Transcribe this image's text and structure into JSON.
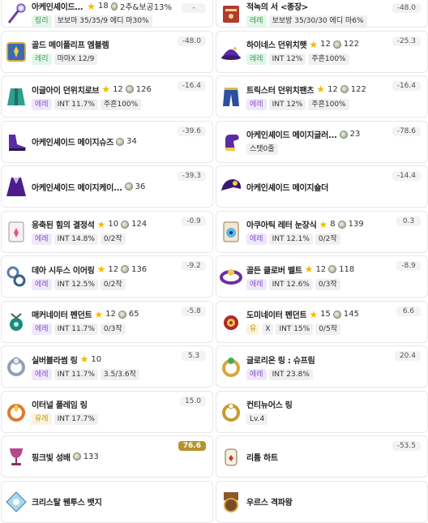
{
  "items": [
    {
      "name": "아케인셰이드 스태프",
      "star": "18",
      "scroll_text": "2추&보공13%",
      "tags": [
        {
          "text": "링리",
          "grade": "legend"
        },
        {
          "text": "보보마 35/35/9 에디 마30%",
          "grade": ""
        }
      ],
      "diff": "-",
      "icon": "staff-icon"
    },
    {
      "name": "적녹의 서 <종장>",
      "star": "",
      "scroll_text": "",
      "tags": [
        {
          "text": "레레",
          "grade": "legend"
        },
        {
          "text": "보보방 35/30/30 에디 마6%",
          "grade": ""
        }
      ],
      "diff": "-48.0",
      "icon": "book-icon"
    },
    {
      "name": "골드 메이플리프 엠블렘",
      "star": "",
      "scroll_text": "",
      "tags": [
        {
          "text": "레리",
          "grade": "legend"
        },
        {
          "text": "마마X 12/9",
          "grade": ""
        }
      ],
      "diff": "-48.0",
      "icon": "emblem-icon"
    },
    {
      "name": "하이네스 던위치햇",
      "star": "12",
      "scroll_text": "122",
      "tags": [
        {
          "text": "레레",
          "grade": "legend"
        },
        {
          "text": "INT 12%",
          "grade": ""
        },
        {
          "text": "주흔100%",
          "grade": ""
        }
      ],
      "diff": "-25.3",
      "icon": "hat-icon"
    },
    {
      "name": "이글아이 던위치로브",
      "star": "12",
      "scroll_text": "126",
      "tags": [
        {
          "text": "에레",
          "grade": "epic"
        },
        {
          "text": "INT 11.7%",
          "grade": ""
        },
        {
          "text": "주흔100%",
          "grade": ""
        }
      ],
      "diff": "-16.4",
      "icon": "robe-icon"
    },
    {
      "name": "트릭스터 던위치팬츠",
      "star": "12",
      "scroll_text": "122",
      "tags": [
        {
          "text": "에레",
          "grade": "epic"
        },
        {
          "text": "INT 12%",
          "grade": ""
        },
        {
          "text": "주흔100%",
          "grade": ""
        }
      ],
      "diff": "-16.4",
      "icon": "pants-icon"
    },
    {
      "name": "아케인셰이드 메이지슈즈",
      "star": "",
      "scroll_text": "34",
      "tags": [],
      "diff": "-39.6",
      "icon": "shoes-icon"
    },
    {
      "name": "아케인셰이드 메이지글러...",
      "star": "",
      "scroll_text": "23",
      "tags": [
        {
          "text": "스탯0줄",
          "grade": ""
        }
      ],
      "diff": "-78.6",
      "icon": "glove-icon"
    },
    {
      "name": "아케인셰이드 메이지케이...",
      "star": "",
      "scroll_text": "36",
      "tags": [],
      "diff": "-39.3",
      "icon": "cape-icon"
    },
    {
      "name": "아케인셰이드 메이지숄더",
      "star": "",
      "scroll_text": "",
      "tags": [],
      "diff": "-14.4",
      "icon": "shoulder-icon"
    },
    {
      "name": "응축된 힘의 결정석",
      "star": "10",
      "scroll_text": "124",
      "tags": [
        {
          "text": "에레",
          "grade": "epic"
        },
        {
          "text": "INT 14.8%",
          "grade": ""
        },
        {
          "text": "0/2작",
          "grade": ""
        }
      ],
      "diff": "-0.9",
      "icon": "pendant-icon"
    },
    {
      "name": "아쿠아틱 레터 눈장식",
      "star": "8",
      "scroll_text": "139",
      "tags": [
        {
          "text": "에레",
          "grade": "epic"
        },
        {
          "text": "INT 12.1%",
          "grade": ""
        },
        {
          "text": "0/2작",
          "grade": ""
        }
      ],
      "diff": "0.3",
      "icon": "eye-icon"
    },
    {
      "name": "데아 시두스 이어링",
      "star": "12",
      "scroll_text": "136",
      "tags": [
        {
          "text": "에레",
          "grade": "epic"
        },
        {
          "text": "INT 12.5%",
          "grade": ""
        },
        {
          "text": "0/2작",
          "grade": ""
        }
      ],
      "diff": "-9.2",
      "icon": "earring-icon"
    },
    {
      "name": "골든 클로버 벨트",
      "star": "12",
      "scroll_text": "118",
      "tags": [
        {
          "text": "에레",
          "grade": "epic"
        },
        {
          "text": "INT 12.6%",
          "grade": ""
        },
        {
          "text": "0/3작",
          "grade": ""
        }
      ],
      "diff": "-8.9",
      "icon": "belt-icon"
    },
    {
      "name": "매커네이터 펜던트",
      "star": "12",
      "scroll_text": "65",
      "tags": [
        {
          "text": "에레",
          "grade": "epic"
        },
        {
          "text": "INT 11.7%",
          "grade": ""
        },
        {
          "text": "0/3작",
          "grade": ""
        }
      ],
      "diff": "-5.8",
      "icon": "pendant2-icon"
    },
    {
      "name": "도미네이터 펜던트",
      "star": "15",
      "scroll_text": "145",
      "tags": [
        {
          "text": "유",
          "grade": "unique"
        },
        {
          "text": "X",
          "grade": ""
        },
        {
          "text": "INT 15%",
          "grade": ""
        },
        {
          "text": "0/5작",
          "grade": ""
        }
      ],
      "diff": "6.6",
      "icon": "pendant3-icon"
    },
    {
      "name": "실버블라썸 링",
      "star": "10",
      "scroll_text": "",
      "tags": [
        {
          "text": "에레",
          "grade": "epic"
        },
        {
          "text": "INT 11.7%",
          "grade": ""
        },
        {
          "text": "3.5/3.6작",
          "grade": ""
        }
      ],
      "diff": "5.3",
      "icon": "ring-icon"
    },
    {
      "name": "글로리온 링 : 슈프림",
      "star": "",
      "scroll_text": "",
      "tags": [
        {
          "text": "에레",
          "grade": "epic"
        },
        {
          "text": "INT 23.8%",
          "grade": ""
        }
      ],
      "diff": "20.4",
      "icon": "ring2-icon"
    },
    {
      "name": "이터널 플레임 링",
      "star": "",
      "scroll_text": "",
      "tags": [
        {
          "text": "유레",
          "grade": "unique"
        },
        {
          "text": "INT 17.7%",
          "grade": ""
        }
      ],
      "diff": "15.0",
      "icon": "ring3-icon"
    },
    {
      "name": "컨티뉴어스 링",
      "star": "",
      "scroll_text": "",
      "tags": [
        {
          "text": "Lv.4",
          "grade": ""
        }
      ],
      "diff": "",
      "icon": "ring4-icon"
    },
    {
      "name": "핑크빛 성배",
      "star": "",
      "scroll_text": "133",
      "tags": [],
      "diff": "76.6",
      "icon": "chalice-icon",
      "hi": true
    },
    {
      "name": "리튬 하트",
      "star": "",
      "scroll_text": "",
      "tags": [],
      "diff": "-53.5",
      "icon": "heart-icon"
    },
    {
      "name": "크리스탈 웬투스 뱃지",
      "star": "",
      "scroll_text": "",
      "tags": [],
      "diff": "",
      "icon": "badge-icon"
    },
    {
      "name": "우르스 격파왕",
      "star": "",
      "scroll_text": "",
      "tags": [],
      "diff": "",
      "icon": "medal-icon"
    }
  ]
}
